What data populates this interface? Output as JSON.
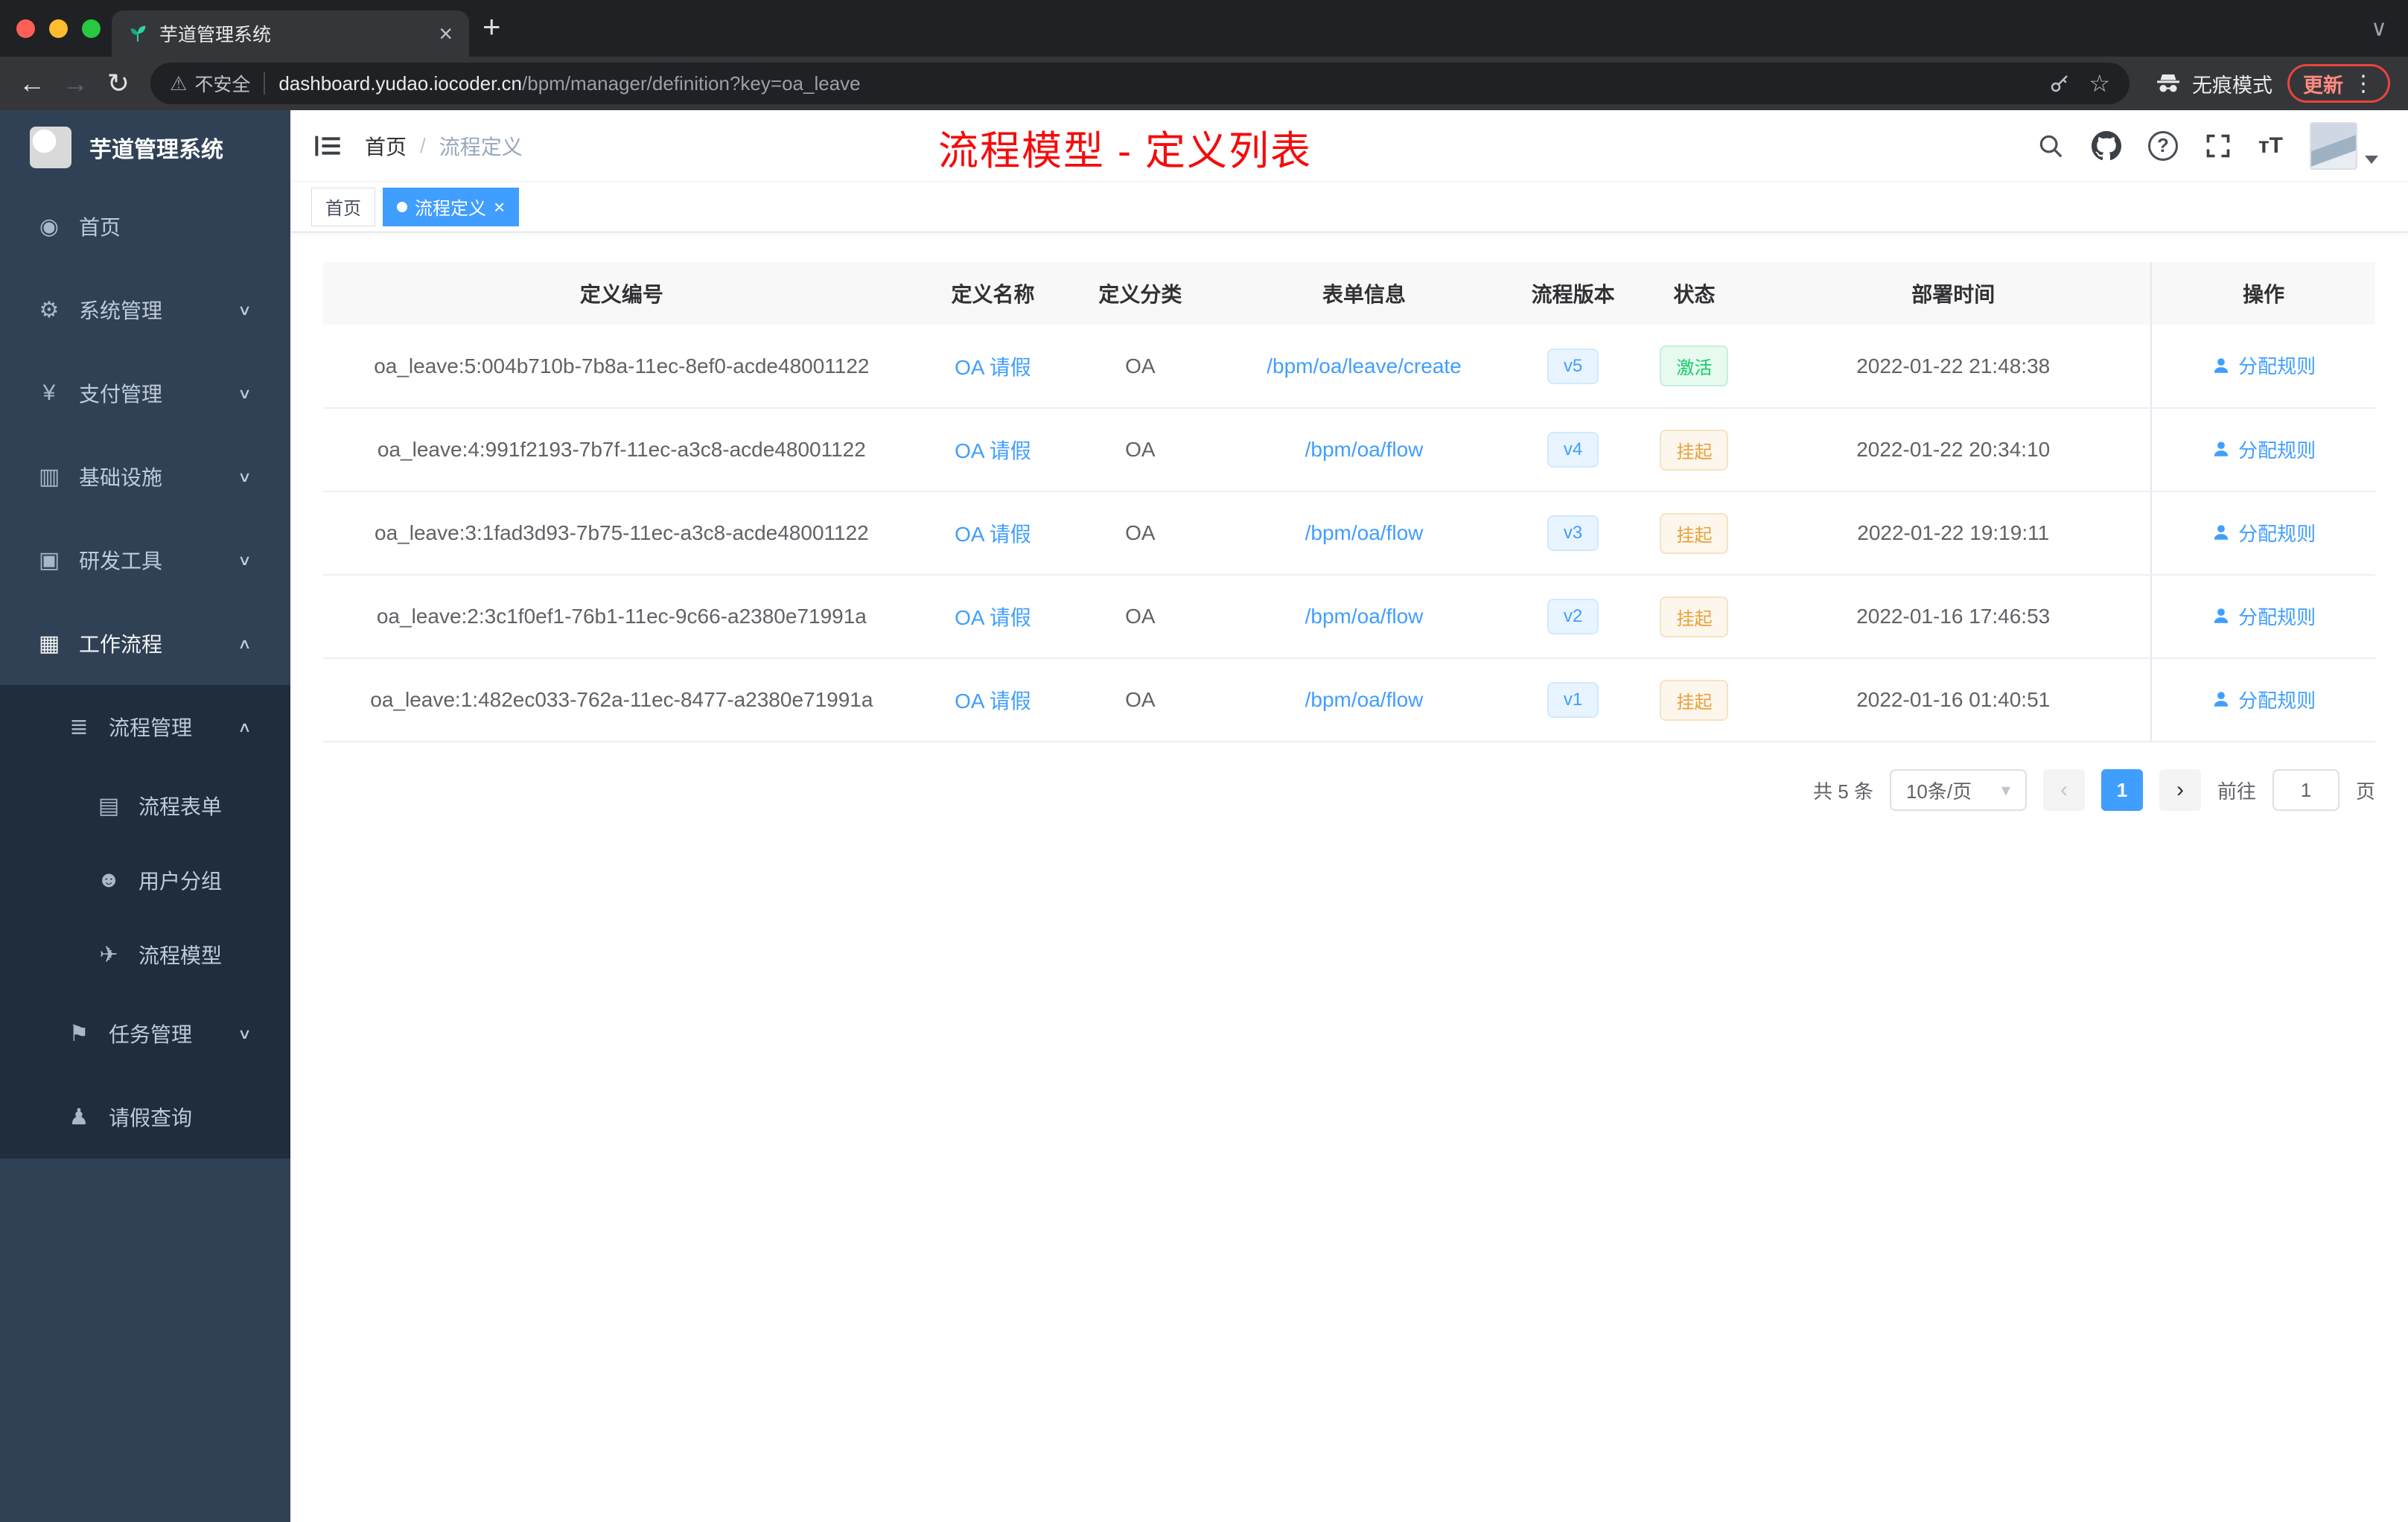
{
  "colors": {
    "accent": "#409eff",
    "annotation_red": "#f40c0c",
    "success": "#13ce66",
    "warning": "#e6a23c",
    "sidebar_bg": "#304156",
    "submenu_bg": "#1f2d3d"
  },
  "icons": {
    "close": "×",
    "plus": "+",
    "kebab": "⋮",
    "star": "☆",
    "warning": "⚠",
    "back": "←",
    "forward": "→",
    "reload": "↻",
    "chevron_down": "∨",
    "chevron_up": "∧",
    "tab_chevron": "∨",
    "caret_down": "▾",
    "pager_prev": "‹",
    "pager_next": "›",
    "breadcrumb_sep": "/",
    "fontsize": "тT"
  },
  "browser": {
    "tab_title": "芋道管理系统",
    "security_label": "不安全",
    "url_host": "dashboard.yudao.iocoder.cn",
    "url_path": "/bpm/manager/definition?key=oa_leave",
    "incognito_label": "无痕模式",
    "update_label": "更新"
  },
  "sidebar": {
    "title": "芋道管理系统",
    "items": [
      {
        "label": "首页",
        "icon": "dashboard-icon",
        "glyph": "◉",
        "level": 1
      },
      {
        "label": "系统管理",
        "icon": "gear-icon",
        "glyph": "⚙",
        "level": 1,
        "chevron": "∨"
      },
      {
        "label": "支付管理",
        "icon": "payment-icon",
        "glyph": "¥",
        "level": 1,
        "chevron": "∨"
      },
      {
        "label": "基础设施",
        "icon": "infrastructure-icon",
        "glyph": "▥",
        "level": 1,
        "chevron": "∨"
      },
      {
        "label": "研发工具",
        "icon": "devtools-icon",
        "glyph": "▣",
        "level": 1,
        "chevron": "∨"
      },
      {
        "label": "工作流程",
        "icon": "workflow-icon",
        "glyph": "▦",
        "level": 1,
        "chevron": "∧",
        "active": true
      },
      {
        "label": "流程管理",
        "icon": "process-list-icon",
        "glyph": "≣",
        "level": 2,
        "chevron": "∧"
      },
      {
        "label": "流程表单",
        "icon": "form-icon",
        "glyph": "▤",
        "level": 3
      },
      {
        "label": "用户分组",
        "icon": "user-group-icon",
        "glyph": "☻",
        "level": 3
      },
      {
        "label": "流程模型",
        "icon": "process-model-icon",
        "glyph": "✈",
        "level": 3
      },
      {
        "label": "任务管理",
        "icon": "task-icon",
        "glyph": "⚑",
        "level": 2,
        "chevron": "∨"
      },
      {
        "label": "请假查询",
        "icon": "leave-query-icon",
        "glyph": "♟",
        "level": 2
      }
    ]
  },
  "header": {
    "breadcrumb_home": "首页",
    "breadcrumb_sep": "/",
    "breadcrumb_current": "流程定义",
    "overlay_title": "流程模型 - 定义列表"
  },
  "tags": {
    "items": [
      {
        "label": "首页",
        "active": false
      },
      {
        "label": "流程定义",
        "active": true
      }
    ]
  },
  "table": {
    "columns": [
      "定义编号",
      "定义名称",
      "定义分类",
      "表单信息",
      "流程版本",
      "状态",
      "部署时间",
      "操作"
    ],
    "rows": [
      {
        "id": "oa_leave:5:004b710b-7b8a-11ec-8ef0-acde48001122",
        "name": "OA 请假",
        "category": "OA",
        "form": "/bpm/oa/leave/create",
        "version": "v5",
        "status": "激活",
        "status_type": "success",
        "time": "2022-01-22 21:48:38",
        "action": "分配规则"
      },
      {
        "id": "oa_leave:4:991f2193-7b7f-11ec-a3c8-acde48001122",
        "name": "OA 请假",
        "category": "OA",
        "form": "/bpm/oa/flow",
        "version": "v4",
        "status": "挂起",
        "status_type": "warning",
        "time": "2022-01-22 20:34:10",
        "action": "分配规则"
      },
      {
        "id": "oa_leave:3:1fad3d93-7b75-11ec-a3c8-acde48001122",
        "name": "OA 请假",
        "category": "OA",
        "form": "/bpm/oa/flow",
        "version": "v3",
        "status": "挂起",
        "status_type": "warning",
        "time": "2022-01-22 19:19:11",
        "action": "分配规则"
      },
      {
        "id": "oa_leave:2:3c1f0ef1-76b1-11ec-9c66-a2380e71991a",
        "name": "OA 请假",
        "category": "OA",
        "form": "/bpm/oa/flow",
        "version": "v2",
        "status": "挂起",
        "status_type": "warning",
        "time": "2022-01-16 17:46:53",
        "action": "分配规则"
      },
      {
        "id": "oa_leave:1:482ec033-762a-11ec-8477-a2380e71991a",
        "name": "OA 请假",
        "category": "OA",
        "form": "/bpm/oa/flow",
        "version": "v1",
        "status": "挂起",
        "status_type": "warning",
        "time": "2022-01-16 01:40:51",
        "action": "分配规则"
      }
    ]
  },
  "pager": {
    "total": "共 5 条",
    "page_size": "10条/页",
    "current_page": "1",
    "goto_label": "前往",
    "goto_value": "1",
    "page_unit": "页"
  }
}
